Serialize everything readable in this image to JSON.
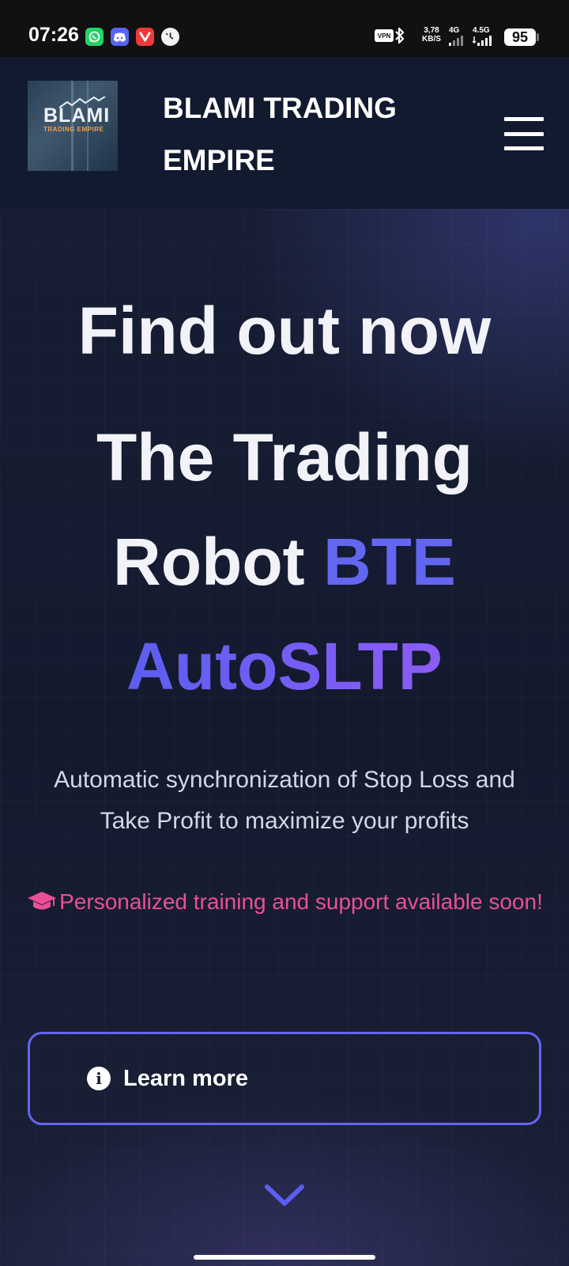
{
  "status_bar": {
    "time": "07:26",
    "apps": [
      "whatsapp-icon",
      "discord-icon",
      "vivaldi-icon",
      "clock-app-icon"
    ],
    "vpn_label": "VPN",
    "net_speed_value": "3,78",
    "net_speed_unit": "KB/S",
    "sim1_label": "4G",
    "sim2_label": "4.5G",
    "battery": "95"
  },
  "navbar": {
    "logo_text": "BLAMI",
    "logo_subtext": "TRADING EMPIRE",
    "brand_line1": "BLAMI TRADING",
    "brand_line2": "EMPIRE",
    "menu_icon": "hamburger-icon"
  },
  "hero": {
    "line1": "Find out now",
    "line2": "The Trading",
    "line3_plain": "Robot ",
    "line3_accent": "BTE",
    "line4_accent": "AutoSLTP",
    "subtitle": "Automatic synchronization of Stop Loss and Take Profit to maximize your profits",
    "promo": "Personalized training and support available soon!",
    "promo_icon": "graduation-cap-icon",
    "cta_label": "Learn more",
    "cta_icon": "info-icon",
    "scroll_icon": "chevron-down-icon"
  },
  "colors": {
    "accent": "#6366f1",
    "accent_purple": "#8b5cf6",
    "promo": "#ec4f95",
    "background": "#141a2e"
  }
}
